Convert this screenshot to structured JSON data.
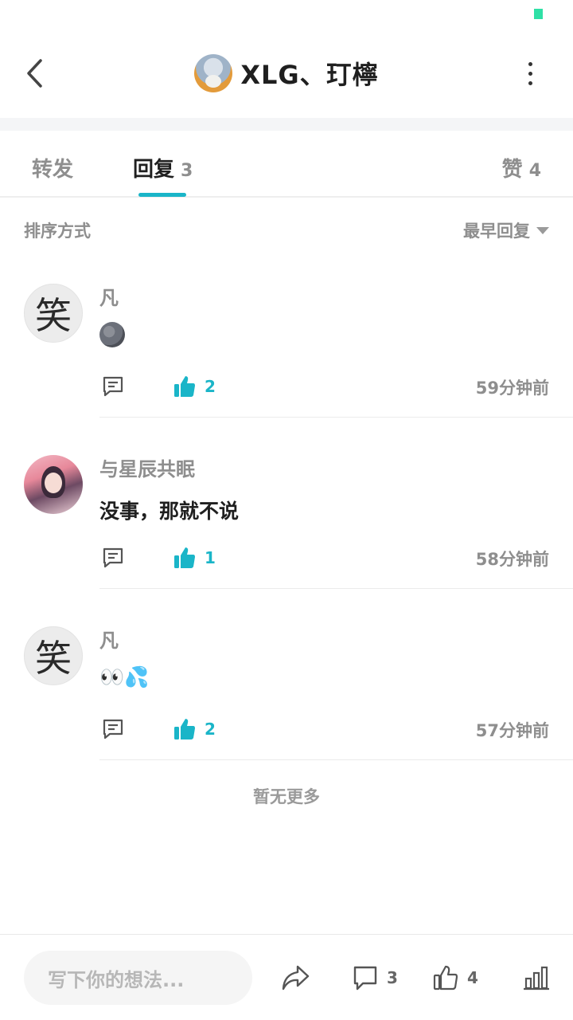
{
  "colors": {
    "accent": "#1ab5c8",
    "status_dot": "#2fe0a6"
  },
  "header": {
    "title": "XLG、玎檸",
    "back_icon": "chevron-left-icon",
    "more_icon": "vertical-dots-icon"
  },
  "tabs": {
    "repost": {
      "label": "转发"
    },
    "reply": {
      "label": "回复",
      "count": "3"
    },
    "like": {
      "label": "赞",
      "count": "4"
    }
  },
  "sort": {
    "label": "排序方式",
    "selected": "最早回复"
  },
  "comments": [
    {
      "name": "凡",
      "avatar_text": "笑",
      "content": "",
      "content_icon": "new-moon-face-emoji",
      "likes": "2",
      "time": "59分钟前"
    },
    {
      "name": "与星辰共眠",
      "avatar_text": "",
      "content": "没事，那就不说",
      "likes": "1",
      "time": "58分钟前"
    },
    {
      "name": "凡",
      "avatar_text": "笑",
      "content": "👀💦",
      "likes": "2",
      "time": "57分钟前"
    }
  ],
  "footer_note": "暂无更多",
  "bottom_bar": {
    "input_placeholder": "写下你的想法...",
    "comment_count": "3",
    "like_count": "4"
  }
}
